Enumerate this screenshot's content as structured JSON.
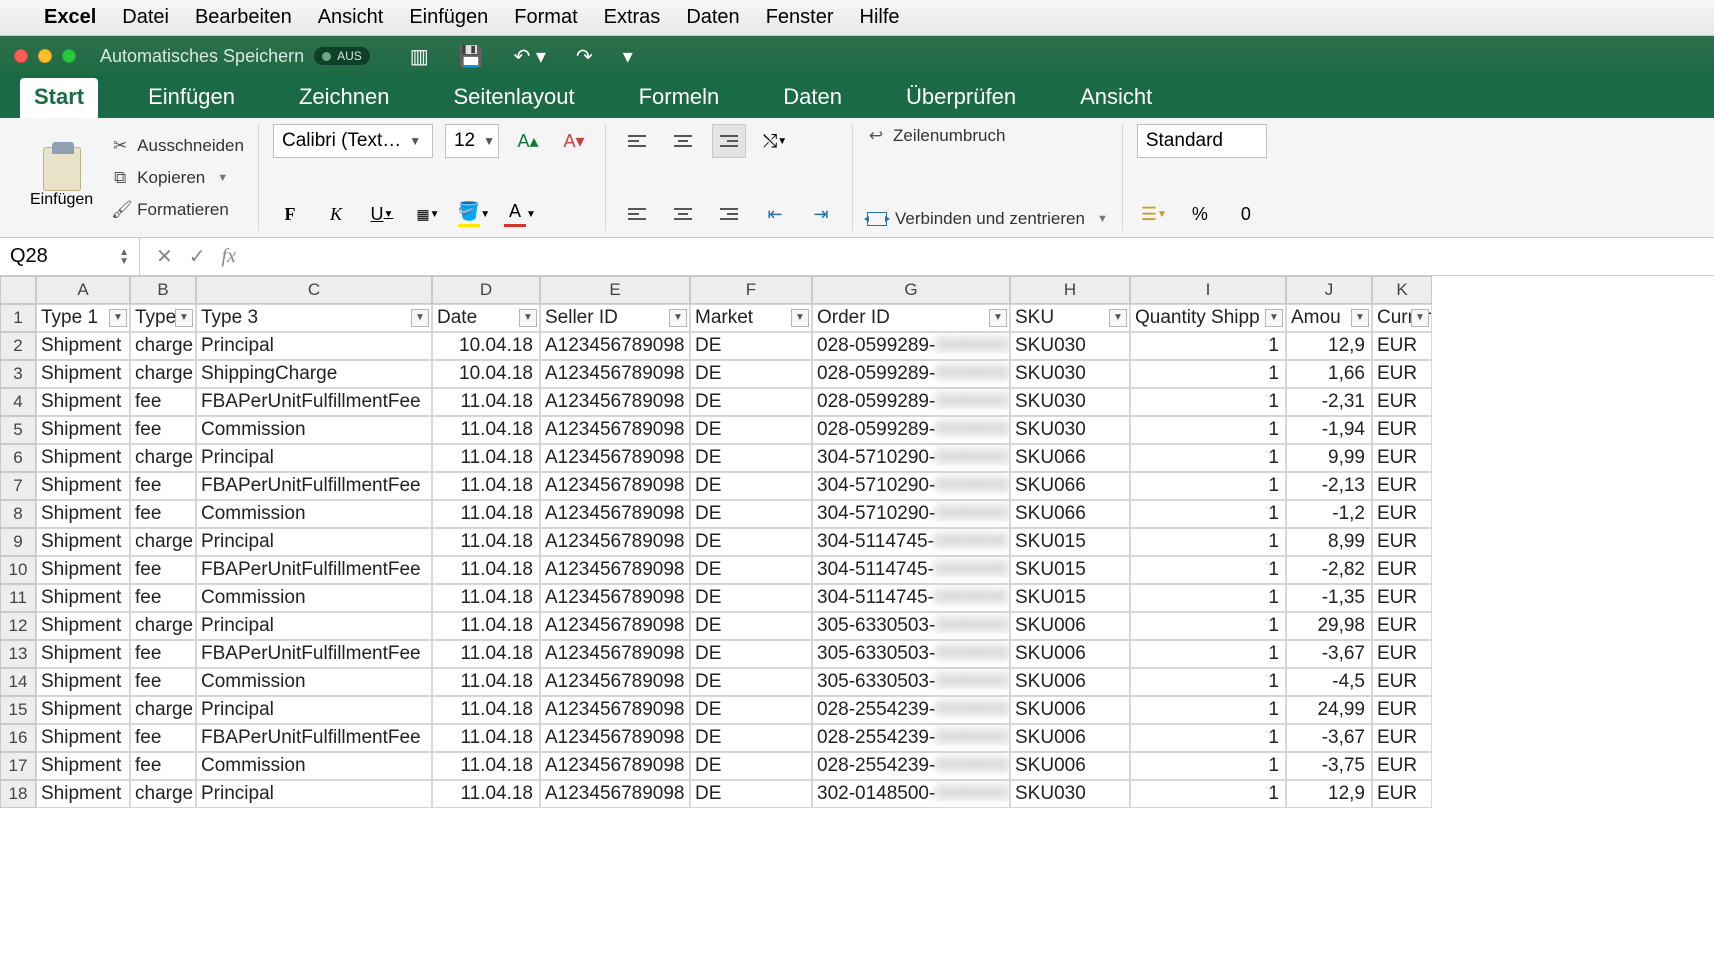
{
  "mac_menu": {
    "app": "Excel",
    "items": [
      "Datei",
      "Bearbeiten",
      "Ansicht",
      "Einfügen",
      "Format",
      "Extras",
      "Daten",
      "Fenster",
      "Hilfe"
    ]
  },
  "titlebar": {
    "autosave_label": "Automatisches Speichern",
    "autosave_state": "AUS"
  },
  "ribbon_tabs": [
    "Start",
    "Einfügen",
    "Zeichnen",
    "Seitenlayout",
    "Formeln",
    "Daten",
    "Überprüfen",
    "Ansicht"
  ],
  "ribbon": {
    "paste": "Einfügen",
    "cut": "Ausschneiden",
    "copy": "Kopieren",
    "format_painter": "Formatieren",
    "font_name": "Calibri (Text…",
    "font_size": "12",
    "wrap": "Zeilenumbruch",
    "merge": "Verbinden und zentrieren",
    "number_format": "Standard",
    "percent": "%",
    "decimals": "0"
  },
  "namebox": "Q28",
  "columns": [
    "A",
    "B",
    "C",
    "D",
    "E",
    "F",
    "G",
    "H",
    "I",
    "J",
    "K"
  ],
  "headers": [
    "Type 1",
    "Type",
    "Type 3",
    "Date",
    "Seller ID",
    "Market",
    "Order ID",
    "SKU",
    "Quantity Shipp",
    "Amou",
    "Curren"
  ],
  "rows": [
    {
      "n": 2,
      "t1": "Shipment",
      "t2": "charge",
      "t3": "Principal",
      "date": "10.04.18",
      "seller": "A123456789098",
      "mkt": "DE",
      "order": "028-0599289-",
      "sku": "SKU030",
      "qty": "1",
      "amt": "12,9",
      "cur": "EUR"
    },
    {
      "n": 3,
      "t1": "Shipment",
      "t2": "charge",
      "t3": "ShippingCharge",
      "date": "10.04.18",
      "seller": "A123456789098",
      "mkt": "DE",
      "order": "028-0599289-",
      "sku": "SKU030",
      "qty": "1",
      "amt": "1,66",
      "cur": "EUR"
    },
    {
      "n": 4,
      "t1": "Shipment",
      "t2": "fee",
      "t3": "FBAPerUnitFulfillmentFee",
      "date": "11.04.18",
      "seller": "A123456789098",
      "mkt": "DE",
      "order": "028-0599289-",
      "sku": "SKU030",
      "qty": "1",
      "amt": "-2,31",
      "cur": "EUR"
    },
    {
      "n": 5,
      "t1": "Shipment",
      "t2": "fee",
      "t3": "Commission",
      "date": "11.04.18",
      "seller": "A123456789098",
      "mkt": "DE",
      "order": "028-0599289-",
      "sku": "SKU030",
      "qty": "1",
      "amt": "-1,94",
      "cur": "EUR"
    },
    {
      "n": 6,
      "t1": "Shipment",
      "t2": "charge",
      "t3": "Principal",
      "date": "11.04.18",
      "seller": "A123456789098",
      "mkt": "DE",
      "order": "304-5710290-",
      "sku": "SKU066",
      "qty": "1",
      "amt": "9,99",
      "cur": "EUR"
    },
    {
      "n": 7,
      "t1": "Shipment",
      "t2": "fee",
      "t3": "FBAPerUnitFulfillmentFee",
      "date": "11.04.18",
      "seller": "A123456789098",
      "mkt": "DE",
      "order": "304-5710290-",
      "sku": "SKU066",
      "qty": "1",
      "amt": "-2,13",
      "cur": "EUR"
    },
    {
      "n": 8,
      "t1": "Shipment",
      "t2": "fee",
      "t3": "Commission",
      "date": "11.04.18",
      "seller": "A123456789098",
      "mkt": "DE",
      "order": "304-5710290-",
      "sku": "SKU066",
      "qty": "1",
      "amt": "-1,2",
      "cur": "EUR"
    },
    {
      "n": 9,
      "t1": "Shipment",
      "t2": "charge",
      "t3": "Principal",
      "date": "11.04.18",
      "seller": "A123456789098",
      "mkt": "DE",
      "order": "304-5114745-",
      "sku": "SKU015",
      "qty": "1",
      "amt": "8,99",
      "cur": "EUR"
    },
    {
      "n": 10,
      "t1": "Shipment",
      "t2": "fee",
      "t3": "FBAPerUnitFulfillmentFee",
      "date": "11.04.18",
      "seller": "A123456789098",
      "mkt": "DE",
      "order": "304-5114745-",
      "sku": "SKU015",
      "qty": "1",
      "amt": "-2,82",
      "cur": "EUR"
    },
    {
      "n": 11,
      "t1": "Shipment",
      "t2": "fee",
      "t3": "Commission",
      "date": "11.04.18",
      "seller": "A123456789098",
      "mkt": "DE",
      "order": "304-5114745-",
      "sku": "SKU015",
      "qty": "1",
      "amt": "-1,35",
      "cur": "EUR"
    },
    {
      "n": 12,
      "t1": "Shipment",
      "t2": "charge",
      "t3": "Principal",
      "date": "11.04.18",
      "seller": "A123456789098",
      "mkt": "DE",
      "order": "305-6330503-",
      "sku": "SKU006",
      "qty": "1",
      "amt": "29,98",
      "cur": "EUR"
    },
    {
      "n": 13,
      "t1": "Shipment",
      "t2": "fee",
      "t3": "FBAPerUnitFulfillmentFee",
      "date": "11.04.18",
      "seller": "A123456789098",
      "mkt": "DE",
      "order": "305-6330503-",
      "sku": "SKU006",
      "qty": "1",
      "amt": "-3,67",
      "cur": "EUR"
    },
    {
      "n": 14,
      "t1": "Shipment",
      "t2": "fee",
      "t3": "Commission",
      "date": "11.04.18",
      "seller": "A123456789098",
      "mkt": "DE",
      "order": "305-6330503-",
      "sku": "SKU006",
      "qty": "1",
      "amt": "-4,5",
      "cur": "EUR"
    },
    {
      "n": 15,
      "t1": "Shipment",
      "t2": "charge",
      "t3": "Principal",
      "date": "11.04.18",
      "seller": "A123456789098",
      "mkt": "DE",
      "order": "028-2554239-",
      "sku": "SKU006",
      "qty": "1",
      "amt": "24,99",
      "cur": "EUR"
    },
    {
      "n": 16,
      "t1": "Shipment",
      "t2": "fee",
      "t3": "FBAPerUnitFulfillmentFee",
      "date": "11.04.18",
      "seller": "A123456789098",
      "mkt": "DE",
      "order": "028-2554239-",
      "sku": "SKU006",
      "qty": "1",
      "amt": "-3,67",
      "cur": "EUR"
    },
    {
      "n": 17,
      "t1": "Shipment",
      "t2": "fee",
      "t3": "Commission",
      "date": "11.04.18",
      "seller": "A123456789098",
      "mkt": "DE",
      "order": "028-2554239-",
      "sku": "SKU006",
      "qty": "1",
      "amt": "-3,75",
      "cur": "EUR"
    },
    {
      "n": 18,
      "t1": "Shipment",
      "t2": "charge",
      "t3": "Principal",
      "date": "11.04.18",
      "seller": "A123456789098",
      "mkt": "DE",
      "order": "302-0148500-",
      "sku": "SKU030",
      "qty": "1",
      "amt": "12,9",
      "cur": "EUR"
    }
  ]
}
